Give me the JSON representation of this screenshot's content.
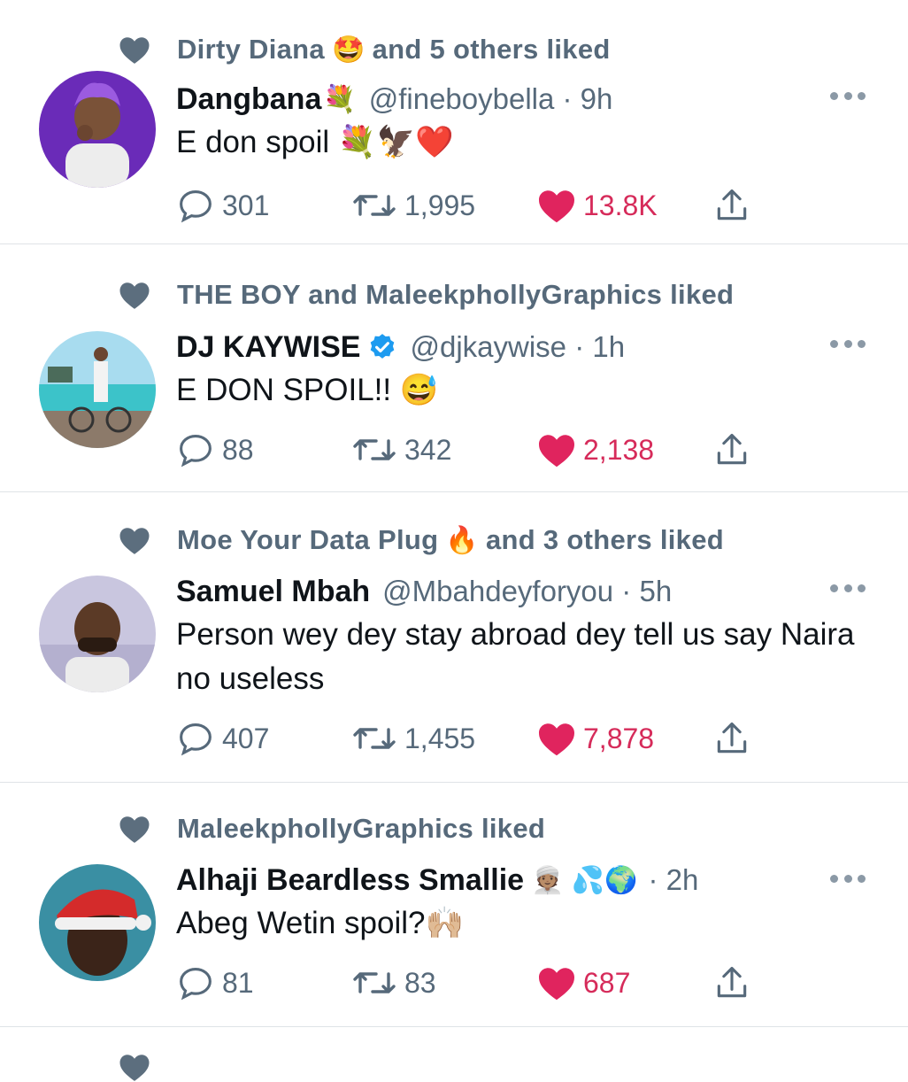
{
  "colors": {
    "like": "#e0245e",
    "secondary": "#56697a",
    "divider": "#dfe3e7",
    "verified": "#1d9bf0"
  },
  "tweets": [
    {
      "social": {
        "text": "Dirty Diana",
        "emoji": "🤩",
        "suffix": "and 5 others liked"
      },
      "author": {
        "name": "Dangbana",
        "name_emoji": "💐",
        "handle": "@fineboybella · 9h",
        "verified": false
      },
      "text": "E don spoil 💐🦅❤️",
      "stats": {
        "replies": "301",
        "retweets": "1,995",
        "likes": "13.8K"
      }
    },
    {
      "social": {
        "text": "THE BOY and MaleekphollyGraphics liked",
        "emoji": "",
        "suffix": ""
      },
      "author": {
        "name": "DJ KAYWISE",
        "name_emoji": "",
        "handle": "@djkaywise · 1h",
        "verified": true
      },
      "text": "E DON SPOIL!! 😅",
      "stats": {
        "replies": "88",
        "retweets": "342",
        "likes": "2,138"
      }
    },
    {
      "social": {
        "text": "Moe Your Data Plug",
        "emoji": "🔥",
        "suffix": "and 3 others liked"
      },
      "author": {
        "name": "Samuel Mbah",
        "name_emoji": "",
        "handle": "@Mbahdeyforyou · 5h",
        "verified": false
      },
      "text": "Person wey dey stay abroad dey tell us say Naira no useless",
      "stats": {
        "replies": "407",
        "retweets": "1,455",
        "likes": "7,878"
      }
    },
    {
      "social": {
        "text": "MaleekphollyGraphics liked",
        "emoji": "",
        "suffix": ""
      },
      "author": {
        "name": "Alhaji Beardless Smallie",
        "name_emoji": "👳🏽 💦🌍",
        "handle": "· 2h",
        "verified": false
      },
      "text": "Abeg Wetin spoil?🙌🏼",
      "stats": {
        "replies": "81",
        "retweets": "83",
        "likes": "687"
      }
    }
  ]
}
